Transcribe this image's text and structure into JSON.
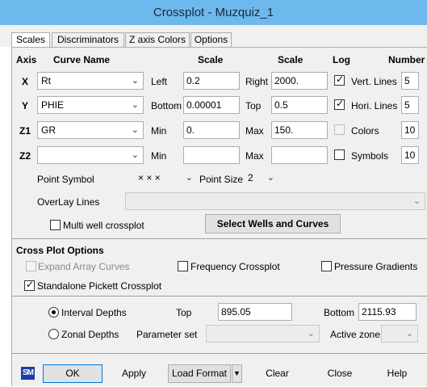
{
  "window": {
    "title": "Crossplot - Muzquiz_1"
  },
  "tabs": [
    {
      "label": "Scales"
    },
    {
      "label": "Discriminators"
    },
    {
      "label": "Z axis Colors"
    },
    {
      "label": "Options"
    }
  ],
  "header": {
    "axis": "Axis",
    "curve_name": "Curve Name",
    "scale": "Scale",
    "scale2": "Scale",
    "log": "Log",
    "number": "Number"
  },
  "rows": {
    "x": {
      "axis": "X",
      "curve": "Rt",
      "lab1": "Left",
      "val1": "0.2",
      "lab2": "Right",
      "val2": "2000.",
      "right_label": "Vert. Lines",
      "right_val": "5"
    },
    "y": {
      "axis": "Y",
      "curve": "PHIE",
      "lab1": "Bottom",
      "val1": "0.00001",
      "lab2": "Top",
      "val2": "0.5",
      "right_label": "Hori. Lines",
      "right_val": "5"
    },
    "z1": {
      "axis": "Z1",
      "curve": "GR",
      "lab1": "Min",
      "val1": "0.",
      "lab2": "Max",
      "val2": "150.",
      "right_label": "Colors",
      "right_val": "10"
    },
    "z2": {
      "axis": "Z2",
      "curve": "",
      "lab1": "Min",
      "val1": "",
      "lab2": "Max",
      "val2": "",
      "right_label": "Symbols",
      "right_val": "10"
    }
  },
  "point_symbol": {
    "label": "Point Symbol",
    "value": "× × ×",
    "size_label": "Point Size",
    "size_value": "2"
  },
  "overlay": {
    "label": "OverLay Lines",
    "value": ""
  },
  "multi_well": {
    "label": "Multi well crossplot"
  },
  "select_wells_label": "Select Wells and Curves",
  "cross_plot_options": {
    "title": "Cross Plot Options",
    "expand_array": "Expand Array Curves",
    "frequency": "Frequency Crossplot",
    "pressure": "Pressure Gradients",
    "pickett": "Standalone Pickett Crossplot"
  },
  "depths": {
    "interval": "Interval Depths",
    "top_label": "Top",
    "top_value": "895.05",
    "bottom_label": "Bottom",
    "bottom_value": "2115.93",
    "zonal": "Zonal Depths",
    "parameter_set_label": "Parameter set",
    "parameter_set_value": "",
    "active_zone_label": "Active zone",
    "active_zone_value": ""
  },
  "buttons": {
    "sm_icon": "SM",
    "ok": "OK",
    "apply": "Apply",
    "load_format": "Load Format",
    "clear": "Clear",
    "close": "Close",
    "help": "Help"
  }
}
